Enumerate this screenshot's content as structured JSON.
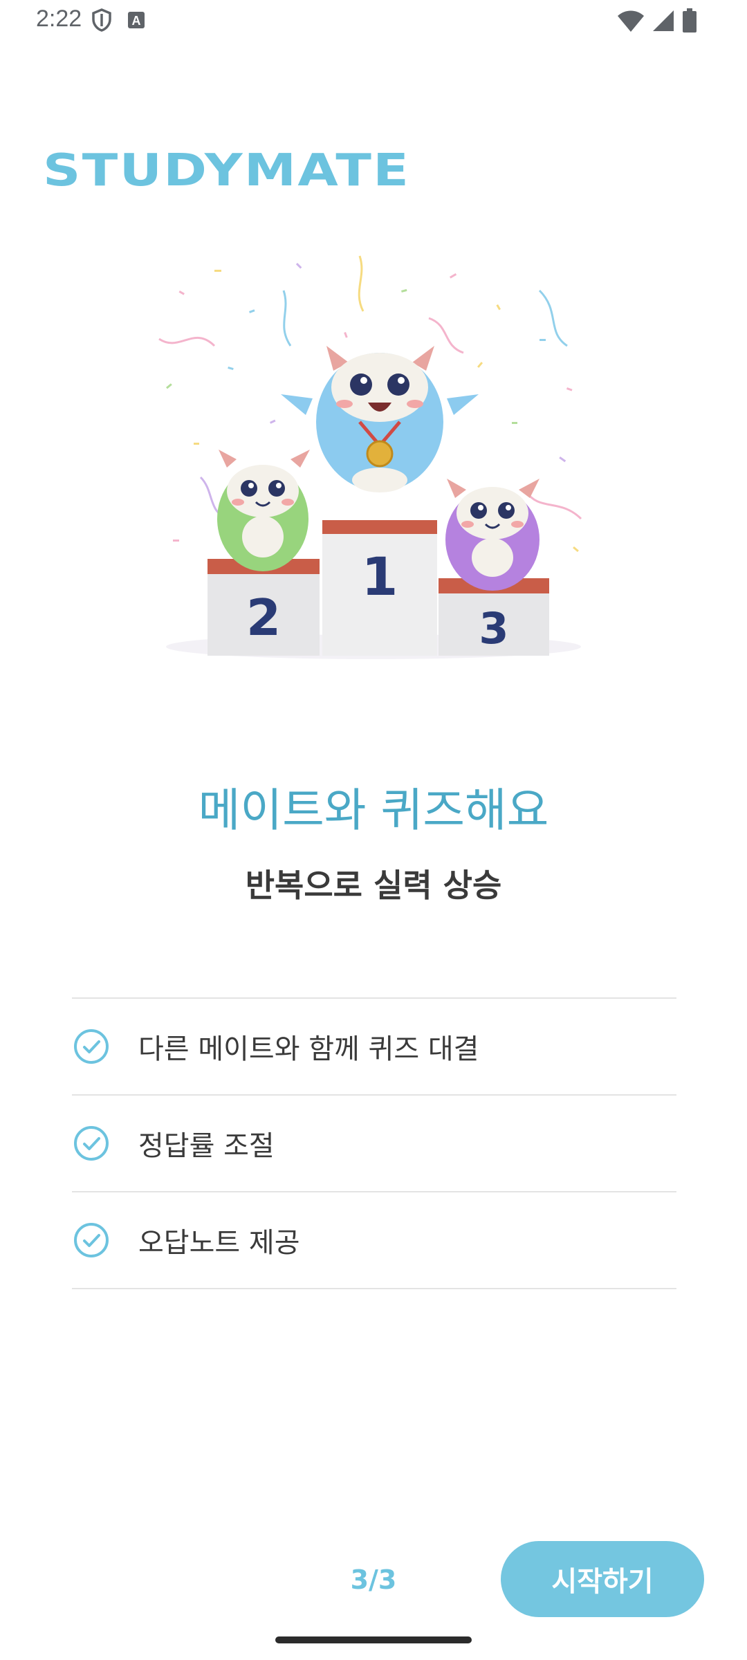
{
  "status_bar": {
    "time": "2:22",
    "left_icons": [
      "shield-icon",
      "keyboard-a-icon"
    ],
    "right_icons": [
      "wifi-icon",
      "signal-icon",
      "battery-icon"
    ]
  },
  "brand": {
    "logo": "STUDYMATE",
    "accent_color": "#6cc3df"
  },
  "illustration": {
    "podium_labels": [
      "1",
      "2",
      "3"
    ]
  },
  "onboarding": {
    "title": "메이트와 퀴즈해요",
    "subtitle": "반복으로 실력 상승",
    "features": [
      {
        "icon": "check-circle-icon",
        "label": "다른 메이트와 함께 퀴즈 대결"
      },
      {
        "icon": "check-circle-icon",
        "label": "정답률 조절"
      },
      {
        "icon": "check-circle-icon",
        "label": "오답노트 제공"
      }
    ]
  },
  "footer": {
    "page_indicator": "3/3",
    "start_button": "시작하기"
  }
}
